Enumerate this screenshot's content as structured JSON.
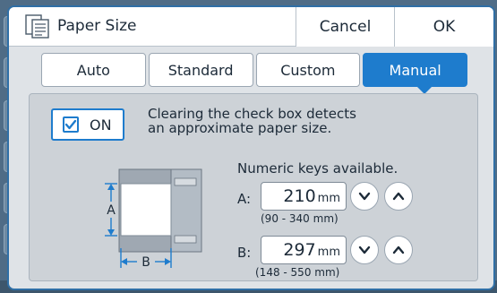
{
  "dialog": {
    "title": "Paper Size",
    "cancel_label": "Cancel",
    "ok_label": "OK",
    "icon": "paper-size-icon"
  },
  "tabs": [
    {
      "label": "Auto",
      "active": false
    },
    {
      "label": "Standard",
      "active": false
    },
    {
      "label": "Custom",
      "active": false
    },
    {
      "label": "Manual",
      "active": true
    }
  ],
  "auto_detect": {
    "label": "ON",
    "checked": true,
    "description": "Clearing the check box detects\nan approximate paper size."
  },
  "diagram": {
    "label_a": "A",
    "label_b": "B"
  },
  "numeric_note": "Numeric keys available.",
  "fields": {
    "a": {
      "label": "A:",
      "value": "210",
      "unit": "mm",
      "range": "(90 - 340 mm)"
    },
    "b": {
      "label": "B:",
      "value": "297",
      "unit": "mm",
      "range": "(148 - 550 mm)"
    }
  },
  "colors": {
    "accent": "#1e7ccd",
    "panel": "#cdd2d7",
    "dialog_bg": "#dfe3e7"
  }
}
